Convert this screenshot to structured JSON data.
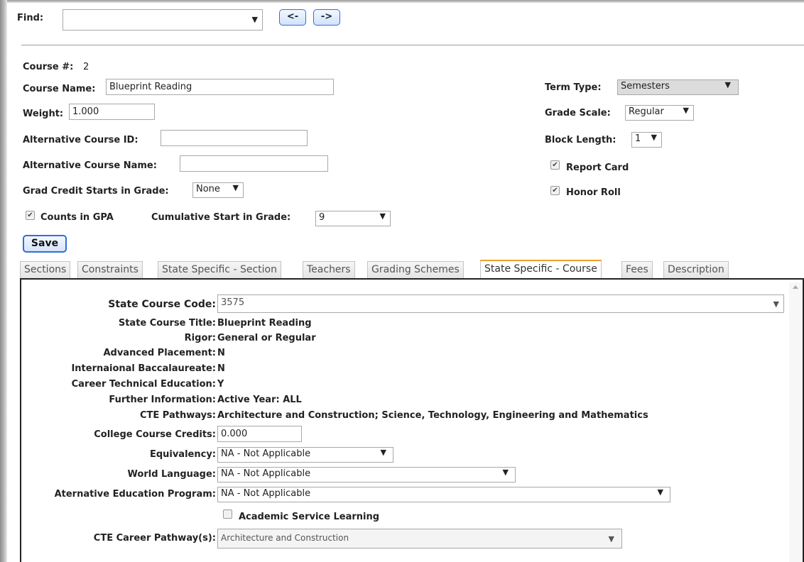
{
  "find": {
    "label": "Find:",
    "value": ""
  },
  "nav": {
    "prev_label": "<-",
    "next_label": "->"
  },
  "course": {
    "number_label": "Course #:",
    "number_value": "2",
    "name_label": "Course Name:",
    "name_value": "Blueprint Reading",
    "weight_label": "Weight:",
    "weight_value": "1.000",
    "alt_id_label": "Alternative Course ID:",
    "alt_id_value": "",
    "alt_name_label": "Alternative Course Name:",
    "alt_name_value": "",
    "grad_credit_label": "Grad Credit Starts in Grade:",
    "grad_credit_value": "None",
    "counts_gpa_label": "Counts in GPA",
    "counts_gpa_checked": true,
    "cumulative_label": "Cumulative Start in Grade:",
    "cumulative_value": "9",
    "term_type_label": "Term Type:",
    "term_type_value": "Semesters",
    "grade_scale_label": "Grade Scale:",
    "grade_scale_value": "Regular",
    "block_length_label": "Block Length:",
    "block_length_value": "1",
    "report_card_label": "Report Card",
    "report_card_checked": true,
    "honor_roll_label": "Honor Roll",
    "honor_roll_checked": true
  },
  "save_label": "Save",
  "tabs": [
    {
      "label": "Sections"
    },
    {
      "label": "Constraints"
    },
    {
      "label": "State Specific - Section"
    },
    {
      "label": "Teachers"
    },
    {
      "label": "Grading Schemes"
    },
    {
      "label": "State Specific - Course",
      "active": true
    },
    {
      "label": "Fees"
    },
    {
      "label": "Description"
    }
  ],
  "state": {
    "course_code_label": "State Course Code:",
    "course_code_value": "3575",
    "title_label": "State Course Title:",
    "title_value": "Blueprint Reading",
    "rigor_label": "Rigor:",
    "rigor_value": "General or Regular",
    "ap_label": "Advanced Placement:",
    "ap_value": "N",
    "ib_label": "Internaional Baccalaureate:",
    "ib_value": "N",
    "cte_label": "Career Technical Education:",
    "cte_value": "Y",
    "further_label": "Further Information:",
    "further_value": "Active Year: ALL",
    "pathways_label": "CTE Pathways:",
    "pathways_value": "Architecture and Construction; Science, Technology, Engineering and Mathematics",
    "credits_label": "College Course Credits:",
    "credits_value": "0.000",
    "equivalency_label": "Equivalency:",
    "equivalency_value": "NA - Not Applicable",
    "world_lang_label": "World Language:",
    "world_lang_value": "NA - Not Applicable",
    "alt_ed_label": "Aternative Education Program:",
    "alt_ed_value": "NA - Not Applicable",
    "service_learning_label": "Academic Service Learning",
    "service_learning_checked": false,
    "career_pathway_label": "CTE Career Pathway(s):",
    "career_pathway_value": "Architecture and Construction"
  },
  "icons": {
    "dropdown_arrow": "▼",
    "check": "✔"
  },
  "colors": {
    "accent": "#2f6fd6",
    "active_tab": "#f0a030"
  }
}
